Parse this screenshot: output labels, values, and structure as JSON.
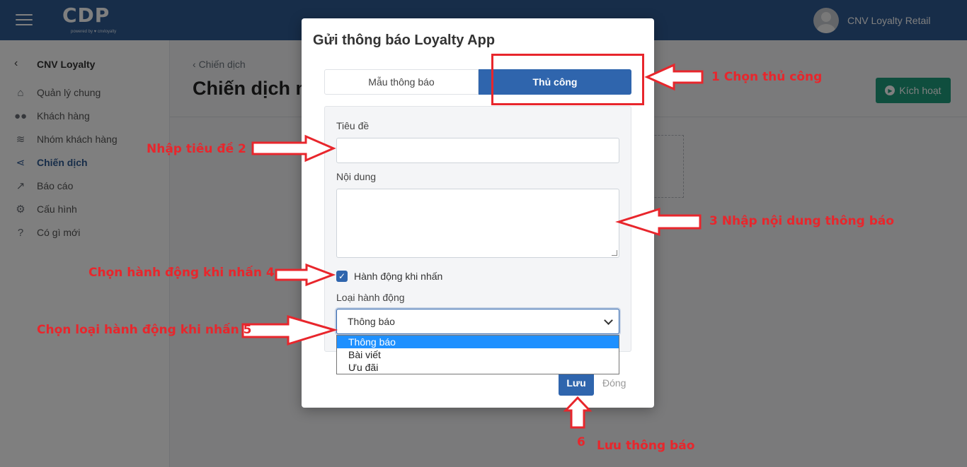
{
  "topbar": {
    "logo": "CDP",
    "logo_sub": "powered by ♥ cnvloyalty",
    "user_name": "CNV Loyalty Retail"
  },
  "sidebar": {
    "title": "CNV Loyalty",
    "items": [
      {
        "label": "Quản lý chung",
        "icon": "home-icon"
      },
      {
        "label": "Khách hàng",
        "icon": "users-icon"
      },
      {
        "label": "Nhóm khách hàng",
        "icon": "layers-icon"
      },
      {
        "label": "Chiến dịch",
        "icon": "share-icon",
        "active": true
      },
      {
        "label": "Báo cáo",
        "icon": "chart-icon"
      },
      {
        "label": "Cấu hình",
        "icon": "gears-icon"
      },
      {
        "label": "Có gì mới",
        "icon": "question-icon"
      }
    ]
  },
  "main": {
    "breadcrumb": "Chiến dịch",
    "page_title": "Chiến dịch m",
    "activate_label": "Kích hoạt"
  },
  "modal": {
    "title": "Gửi thông báo Loyalty App",
    "tabs": [
      "Mẫu thông báo",
      "Thủ công"
    ],
    "active_tab": "Thủ công",
    "title_label": "Tiêu đề",
    "title_value": "",
    "content_label": "Nội dung",
    "content_value": "",
    "checkbox_label": "Hành động khi nhấn",
    "checkbox_checked": true,
    "action_type_label": "Loại hành động",
    "action_type_selected": "Thông báo",
    "action_type_options": [
      "Thông báo",
      "Bài viết",
      "Ưu đãi"
    ],
    "save_label": "Lưu",
    "close_label": "Đóng"
  },
  "annotations": {
    "a1": "1   Chọn thủ công",
    "a2": "Nhập tiêu đề   2",
    "a3": "3    Nhập nội dung thông báo",
    "a4": "Chọn hành động khi nhấn    4",
    "a5": "Chọn loại hành động khi nhấn   5",
    "a6_num": "6",
    "a6": "Lưu thông báo"
  },
  "colors": {
    "topbar": "#2f5b93",
    "primary": "#2f65ad",
    "annotation_red": "#e8262c",
    "activate": "#1f9d7c"
  }
}
